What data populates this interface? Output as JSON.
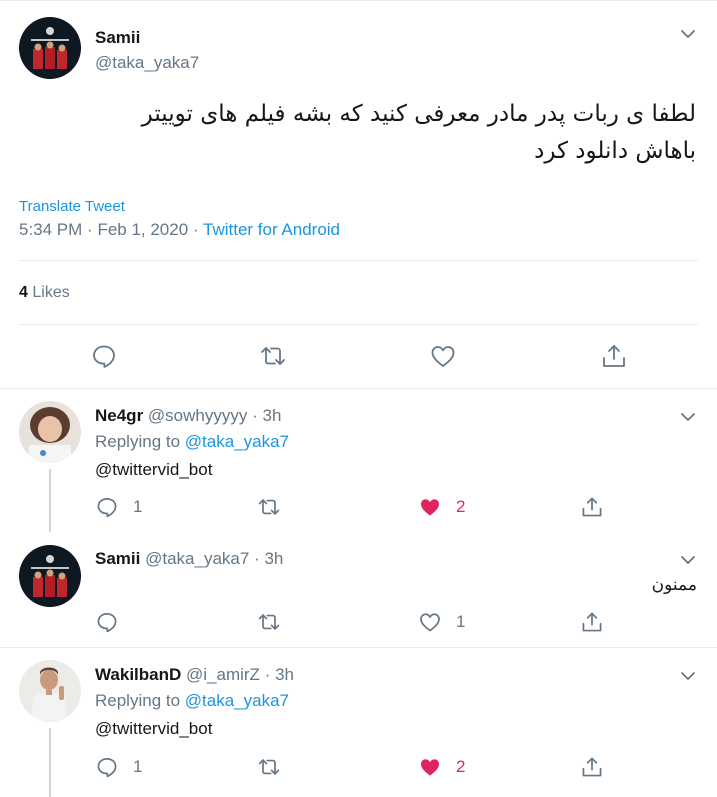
{
  "main_tweet": {
    "display_name": "Samii",
    "handle": "@taka_yaka7",
    "text_line1": "لطفا ی ربات پدر مادر معرفی کنید که بشه فیلم های توییتر",
    "text_line2": "باهاش دانلود کرد",
    "translate_label": "Translate Tweet",
    "time": "5:34 PM",
    "date": "Feb 1, 2020",
    "source": "Twitter for Android",
    "likes_count": "4",
    "likes_label": "Likes",
    "icons": [
      "reply-icon",
      "retweet-icon",
      "like-icon",
      "share-icon",
      "chevron-down-icon"
    ]
  },
  "replies": [
    {
      "display_name": "Ne4gr",
      "handle": "@sowhyyyyy",
      "separator": "·",
      "time": "3h",
      "replying_prefix": "Replying to",
      "replying_to": "@taka_yaka7",
      "text": "@twittervid_bot",
      "reply_count": "1",
      "retweet_count": "",
      "like_count": "2",
      "liked": true
    },
    {
      "display_name": "Samii",
      "handle": "@taka_yaka7",
      "separator": "·",
      "time": "3h",
      "text": "ممنون",
      "reply_count": "",
      "retweet_count": "",
      "like_count": "1",
      "liked": false
    },
    {
      "display_name": "WakilbanD",
      "handle": "@i_amirZ",
      "separator": "·",
      "time": "3h",
      "replying_prefix": "Replying to",
      "replying_to": "@taka_yaka7",
      "text": "@twittervid_bot",
      "reply_count": "1",
      "retweet_count": "",
      "like_count": "2",
      "liked": true
    }
  ],
  "colors": {
    "link_blue": "#1b95e0",
    "secondary_text": "#657786",
    "primary_text": "#14171a",
    "like_red": "#e0245e",
    "divider": "#e6ecf0"
  }
}
